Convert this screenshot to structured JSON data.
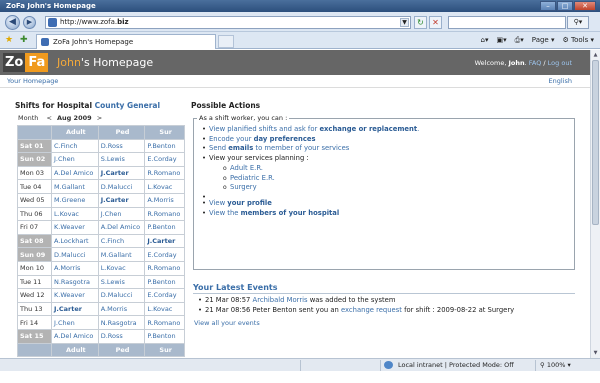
{
  "browser": {
    "title": "ZoFa John's Homepage",
    "url_prefix": "http://www.zofa.",
    "url_domain": "biz",
    "tab_title": "ZoFa John's Homepage",
    "tools": {
      "page": "Page",
      "tools": "Tools"
    },
    "status": {
      "zone": "Local intranet | Protected Mode: Off",
      "zoom": "100%"
    }
  },
  "header": {
    "logo_zo": "Zo",
    "logo_fa": "Fa",
    "title_highlight": "John",
    "title_rest": "'s Homepage",
    "welcome": "Welcome, ",
    "user": "John",
    "faq": "FAQ",
    "logout": "Log out"
  },
  "subnav": {
    "home": "Your Homepage",
    "language": "English"
  },
  "shifts": {
    "title": "Shifts for Hospital ",
    "hospital": "County General",
    "month_label": "Month",
    "prev": "<",
    "month": "Aug 2009",
    "next": ">",
    "columns": [
      "",
      "Adult",
      "Ped",
      "Sur"
    ],
    "rows": [
      {
        "day": "Sat 01",
        "weekend": true,
        "cells": [
          "C.Finch",
          "D.Ross",
          "P.Benton"
        ]
      },
      {
        "day": "Sun 02",
        "weekend": true,
        "cells": [
          "J.Chen",
          "S.Lewis",
          "E.Corday"
        ]
      },
      {
        "day": "Mon 03",
        "weekend": false,
        "cells": [
          "A.Del Amico",
          "J.Carter",
          "R.Romano"
        ]
      },
      {
        "day": "Tue 04",
        "weekend": false,
        "cells": [
          "M.Gallant",
          "D.Malucci",
          "L.Kovac"
        ]
      },
      {
        "day": "Wed 05",
        "weekend": false,
        "cells": [
          "M.Greene",
          "J.Carter",
          "A.Morris"
        ]
      },
      {
        "day": "Thu 06",
        "weekend": false,
        "cells": [
          "L.Kovac",
          "J.Chen",
          "R.Romano"
        ]
      },
      {
        "day": "Fri 07",
        "weekend": false,
        "cells": [
          "K.Weaver",
          "A.Del Amico",
          "P.Benton"
        ]
      },
      {
        "day": "Sat 08",
        "weekend": true,
        "cells": [
          "A.Lockhart",
          "C.Finch",
          "J.Carter"
        ]
      },
      {
        "day": "Sun 09",
        "weekend": true,
        "cells": [
          "D.Malucci",
          "M.Gallant",
          "E.Corday"
        ]
      },
      {
        "day": "Mon 10",
        "weekend": false,
        "cells": [
          "A.Morris",
          "L.Kovac",
          "R.Romano"
        ]
      },
      {
        "day": "Tue 11",
        "weekend": false,
        "cells": [
          "N.Rasgotra",
          "S.Lewis",
          "P.Benton"
        ]
      },
      {
        "day": "Wed 12",
        "weekend": false,
        "cells": [
          "K.Weaver",
          "D.Malucci",
          "E.Corday"
        ]
      },
      {
        "day": "Thu 13",
        "weekend": false,
        "cells": [
          "J.Carter",
          "A.Morris",
          "L.Kovac"
        ]
      },
      {
        "day": "Fri 14",
        "weekend": false,
        "cells": [
          "J.Chen",
          "N.Rasgotra",
          "R.Romano"
        ]
      },
      {
        "day": "Sat 15",
        "weekend": true,
        "cells": [
          "A.Del Amico",
          "D.Ross",
          "P.Benton"
        ]
      }
    ],
    "highlight_name": "J.Carter"
  },
  "actions": {
    "title": "Possible Actions",
    "legend": "As a shift worker, you can :",
    "a1_pre": "View planified shifts and ask for ",
    "a1_link": "exchange or replacement",
    "a1_post": ".",
    "a2_pre": "Encode your ",
    "a2_link": "day preferences",
    "a3_pre": "Send ",
    "a3_link": "emails",
    "a3_post": " to member of your services",
    "a4": "View your services planning :",
    "services": [
      "Adult E.R.",
      "Pediatric E.R.",
      "Surgery"
    ],
    "a5_pre": "View ",
    "a5_link": "your profile",
    "a6_pre": "View the ",
    "a6_link": "members of your hospital"
  },
  "events": {
    "title": "Your Latest Events",
    "e1_time": "21 Mar 08:57 ",
    "e1_name": "Archibald Morris",
    "e1_rest": " was added to the system",
    "e2_time": "21 Mar 08:56 Peter Benton sent you an ",
    "e2_link": "exchange request",
    "e2_rest": " for shift : 2009-08-22 at Surgery",
    "all": "View all your events"
  }
}
